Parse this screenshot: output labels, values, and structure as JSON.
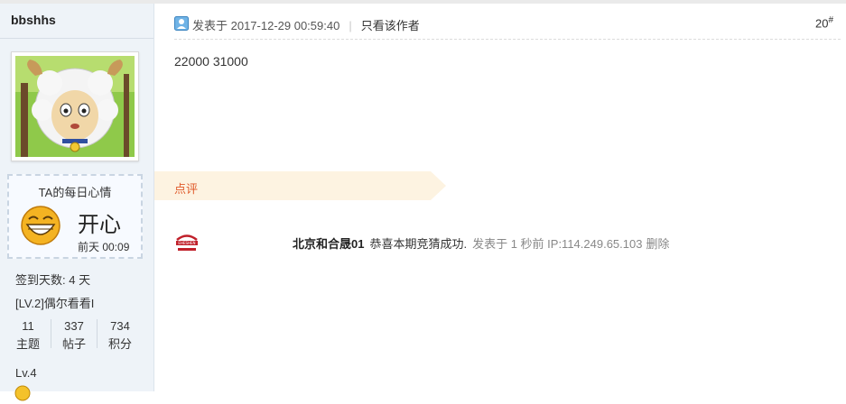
{
  "author": {
    "username": "bbshhs",
    "mood": {
      "title": "TA的每日心情",
      "state": "开心",
      "time": "前天 00:09",
      "face_icon": "laughing-face-icon"
    },
    "signin_days": "签到天数: 4 天",
    "level_name": "[LV.2]偶尔看看I",
    "stats": [
      {
        "value": "11",
        "label": "主题"
      },
      {
        "value": "337",
        "label": "帖子"
      },
      {
        "value": "734",
        "label": "积分"
      }
    ],
    "level": "Lv.4"
  },
  "post": {
    "posted_at": "发表于 2017-12-29 00:59:40",
    "separator": "|",
    "only_author": "只看该作者",
    "floor": "20",
    "floor_mark": "#",
    "content": "22000 31000"
  },
  "comments": {
    "label": "点评",
    "items": [
      {
        "user": "北京和合晟01",
        "text": "恭喜本期竞猜成功.",
        "meta": "发表于 1 秒前 IP:114.249.65.103",
        "delete": "删除",
        "logo_text": "EHESHEN"
      }
    ]
  },
  "colors": {
    "sidebar_bg": "#eef3f8",
    "comment_bar": "#fdf3e1",
    "comment_label": "#e05a2a"
  }
}
